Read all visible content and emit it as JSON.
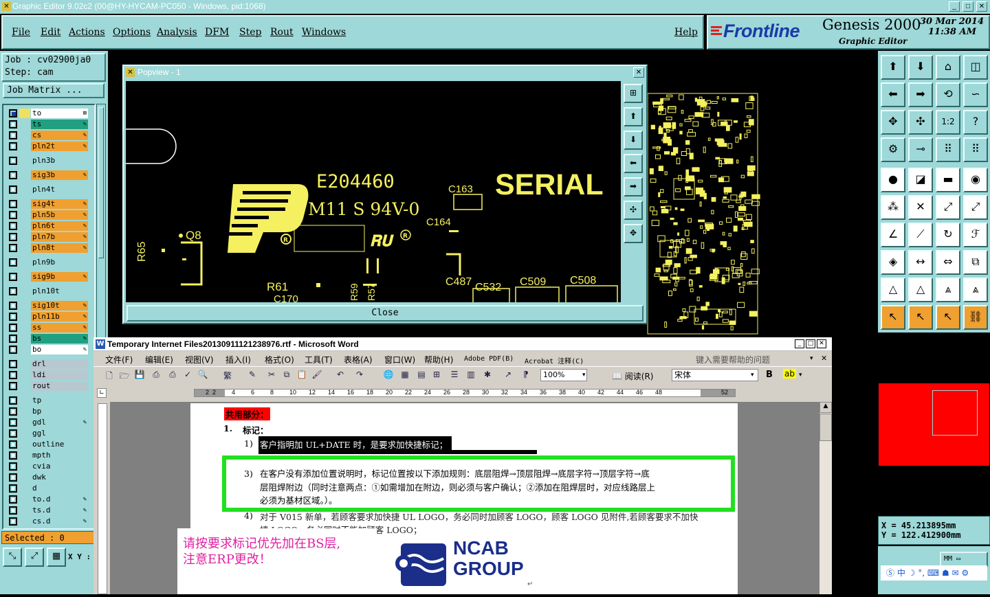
{
  "app": {
    "title": "Graphic Editor 9.02c2 (00@HY-HYCAM-PC050 - Windows, pid:1068)",
    "menu": [
      "File",
      "Edit",
      "Actions",
      "Options",
      "Analysis",
      "DFM",
      "Step",
      "Rout",
      "Windows"
    ],
    "help": "Help",
    "brand": "Frontline",
    "product": "Genesis 2000",
    "subtitle": "Graphic Editor",
    "date": "30 Mar 2014",
    "time": "11:38 AM"
  },
  "job": {
    "job_label": "Job : cv02900ja0",
    "step_label": "Step: cam",
    "matrix_button": "Job Matrix ...",
    "selected": "Selected : 0",
    "xy_label": "X Y :"
  },
  "layers": [
    {
      "name": "to",
      "color": "#ffffff",
      "mark": "⊞"
    },
    {
      "name": "ts",
      "color": "#20a080",
      "mark": "✎"
    },
    {
      "name": "cs",
      "color": "#f0a030",
      "mark": "✎"
    },
    {
      "name": "pln2t",
      "color": "#f0a030",
      "mark": "✎"
    },
    {
      "name": "pln3b",
      "color": "#9ed8d8",
      "mark": ""
    },
    {
      "name": "sig3b",
      "color": "#f0a030",
      "mark": "✎"
    },
    {
      "name": "pln4t",
      "color": "#9ed8d8",
      "mark": ""
    },
    {
      "name": "sig4t",
      "color": "#f0a030",
      "mark": "✎"
    },
    {
      "name": "pln5b",
      "color": "#f0a030",
      "mark": "✎"
    },
    {
      "name": "pln6t",
      "color": "#f0a030",
      "mark": "✎"
    },
    {
      "name": "pln7b",
      "color": "#f0a030",
      "mark": "✎"
    },
    {
      "name": "pln8t",
      "color": "#f0a030",
      "mark": "✎"
    },
    {
      "name": "pln9b",
      "color": "#9ed8d8",
      "mark": ""
    },
    {
      "name": "sig9b",
      "color": "#f0a030",
      "mark": "✎"
    },
    {
      "name": "pln10t",
      "color": "#9ed8d8",
      "mark": ""
    },
    {
      "name": "sig10t",
      "color": "#f0a030",
      "mark": "✎"
    },
    {
      "name": "pln11b",
      "color": "#f0a030",
      "mark": "✎"
    },
    {
      "name": "ss",
      "color": "#f0a030",
      "mark": "✎"
    },
    {
      "name": "bs",
      "color": "#20a080",
      "mark": "✎"
    },
    {
      "name": "bo",
      "color": "#ffffff",
      "mark": "✎"
    },
    {
      "name": "drl",
      "color": "#b8c8d0",
      "mark": ""
    },
    {
      "name": "ldi",
      "color": "#b8c8d0",
      "mark": ""
    },
    {
      "name": "rout",
      "color": "#b8c8d0",
      "mark": ""
    },
    {
      "name": "tp",
      "color": "#9ed8d8",
      "mark": ""
    },
    {
      "name": "bp",
      "color": "#9ed8d8",
      "mark": ""
    },
    {
      "name": "gdl",
      "color": "#9ed8d8",
      "mark": "✎"
    },
    {
      "name": "ggl",
      "color": "#9ed8d8",
      "mark": ""
    },
    {
      "name": "outline",
      "color": "#9ed8d8",
      "mark": ""
    },
    {
      "name": "mpth",
      "color": "#9ed8d8",
      "mark": ""
    },
    {
      "name": "cvia",
      "color": "#9ed8d8",
      "mark": ""
    },
    {
      "name": "dwk",
      "color": "#9ed8d8",
      "mark": ""
    },
    {
      "name": "d",
      "color": "#9ed8d8",
      "mark": ""
    },
    {
      "name": "to.d",
      "color": "#9ed8d8",
      "mark": "✎"
    },
    {
      "name": "ts.d",
      "color": "#9ed8d8",
      "mark": "✎"
    },
    {
      "name": "cs.d",
      "color": "#9ed8d8",
      "mark": "✎"
    }
  ],
  "popview": {
    "title": "Popview - 1",
    "close_label": "Close",
    "pcb_text": {
      "ul_number": "E204460",
      "rating": "M11 S 94V-0",
      "serial": "SERIAL",
      "c163": "C163",
      "c164": "C164",
      "q8": "Q8",
      "r65": "R65",
      "r61": "R61",
      "c170": "C170",
      "r59": "R59",
      "r57": "R57",
      "c487": "C487",
      "c532": "C532",
      "c509": "C509",
      "c508": "C508"
    }
  },
  "coords": {
    "x": "X  =  45.213895mm",
    "y": "Y  = 122.412900mm",
    "unit": "MM"
  },
  "word": {
    "title": "Temporary Internet Files20130911121238976.rtf - Microsoft Word",
    "menu": [
      "文件(F)",
      "编辑(E)",
      "视图(V)",
      "插入(I)",
      "格式(O)",
      "工具(T)",
      "表格(A)",
      "窗口(W)",
      "帮助(H)",
      "Adobe PDF(B)",
      "Acrobat 注释(C)"
    ],
    "help_box": "键入需要帮助的问题",
    "zoom": "100%",
    "reading": "阅读(R)",
    "font": "宋体",
    "bold": "B",
    "ruler": [
      "2",
      "2",
      "4",
      "6",
      "8",
      "10",
      "12",
      "14",
      "16",
      "18",
      "20",
      "22",
      "24",
      "26",
      "28",
      "30",
      "32",
      "34",
      "36",
      "38",
      "40",
      "42",
      "44",
      "46",
      "48",
      "52"
    ],
    "heading": "共用部分：",
    "item1_num": "1.",
    "item1_title": "标记：",
    "line1_num": "1)",
    "line1": "客户指明加 UL+DATE 时，是要求加快捷标记；",
    "line3_num": "3)",
    "line3a": "在客户没有添加位置说明时，标记位置按以下添加规则：底层阻焊→顶层阻焊→底层字符→顶层字符→底",
    "line3b": "层阻焊附边（同时注意两点：①如需增加在附边，则必须与客户确认；②添加在阻焊层时，对应线路层上",
    "line3c": "必须为基材区域。）。",
    "line4_num": "4)",
    "line4a": "对于 V015 新单，若顾客要求加快捷 UL LOGO，务必同时加顾客 LOGO，顾客 LOGO 见附件,若顾客要求不加快",
    "line4b": "捷 LOGO，务必同时不能加顾客 LOGO；",
    "note1": "请按要求标记优先加在BS层,",
    "note2": "注意ERP更改！",
    "ncab1": "NCAB",
    "ncab2": "GROUP"
  }
}
